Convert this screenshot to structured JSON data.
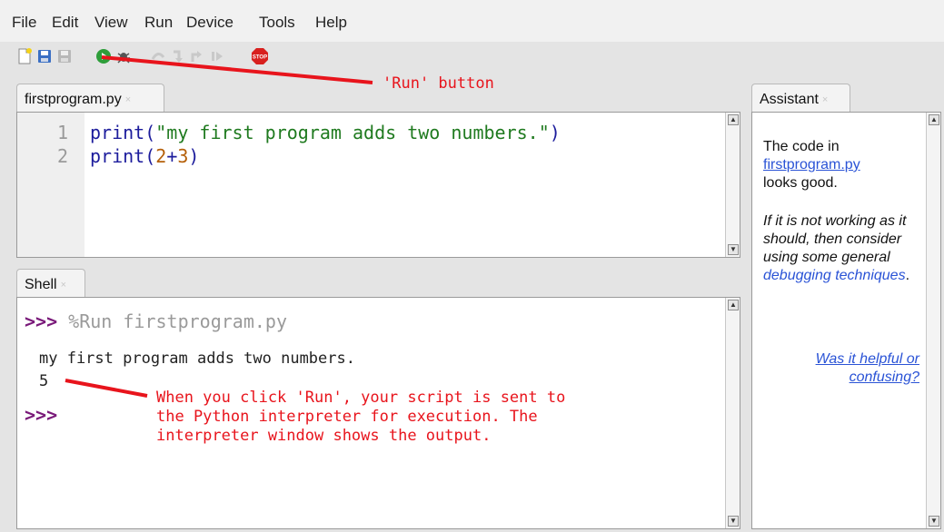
{
  "menu": [
    "File",
    "Edit",
    "View",
    "Run",
    "Device",
    "Tools",
    "Help"
  ],
  "toolbar": {
    "buttons": [
      "new-file-icon",
      "open-icon",
      "save-icon",
      "run-icon",
      "debug-icon",
      "step-over-icon",
      "step-into-icon",
      "step-out-icon",
      "resume-icon",
      "stop-icon"
    ],
    "stop_label": "STOP"
  },
  "editor": {
    "tab_label": "firstprogram.py",
    "tab_close": "×",
    "lines": [
      {
        "num": "1",
        "func": "print",
        "open": "(",
        "arg": "\"my first program adds two numbers.\"",
        "close": ")"
      },
      {
        "num": "2",
        "func": "print",
        "open": "(",
        "arg1": "2",
        "op": "+",
        "arg2": "3",
        "close": ")"
      }
    ]
  },
  "shell": {
    "tab_label": "Shell",
    "tab_close": "×",
    "prompt": ">>>",
    "command": "%Run firstprogram.py",
    "output_line1": "my first program adds two numbers.",
    "output_line2": "5",
    "prompt2": ">>>"
  },
  "assistant": {
    "tab_label": "Assistant",
    "tab_close": "×",
    "p1_text": "The code in",
    "p1_link": "firstprogram.py",
    "p1_end": "looks good.",
    "p2_text": "If it is not working as it should, then consider using some general",
    "p2_link": "debugging techniques",
    "p2_end": ".",
    "feedback_link": "Was it helpful or confusing?"
  },
  "annotations": {
    "run_button": "'Run' button",
    "explanation": "When you click 'Run', your script is sent to\nthe Python interpreter for execution. The\ninterpreter window shows the output."
  },
  "colors": {
    "annotation": "#e8141c",
    "prompt": "#7a1a7a",
    "string": "#1f7a1f",
    "number": "#b5600a",
    "link": "#2a53d6"
  }
}
